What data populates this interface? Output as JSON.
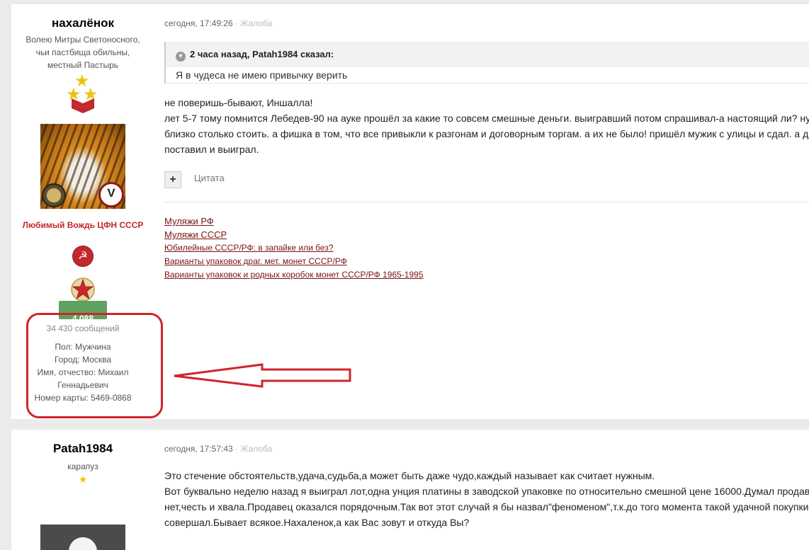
{
  "post1": {
    "author": {
      "name": "нахалёнок",
      "title_lines": [
        "Волею Митры Светоносного,",
        "чьи пастбища обильны,",
        "местный Пастырь"
      ],
      "group": "Любимый Вождь ЦФН СССР",
      "reputation": "4 088",
      "posts_count": "34 430 сообщений",
      "fields": [
        {
          "label": "Пол:",
          "value": "Мужчина"
        },
        {
          "label": "Город:",
          "value": "Москва"
        },
        {
          "label": "Имя, отчество:",
          "value": "Михаил Геннадьевич"
        },
        {
          "label": "Номер карты:",
          "value": "5469-0868"
        }
      ]
    },
    "date": "сегодня, 17:49:26",
    "report": "· Жалоба",
    "quote": {
      "header": "2 часа назад, Patah1984 сказал:",
      "body": "Я в чудеса не имею привычку верить"
    },
    "content": [
      "не поверишь-бывают, Иншалла!",
      "лет 5-7 тому помнится Лебедев-90 на ауке прошёл за какие то совсем смешные деньги. выигравший потом спрашивал-а настоящий ли? ну",
      "близко столько стоить. а фишка в том, что все привыкли к разгонам и договорным торгам. а их не было! пришёл мужик с улицы и сдал. а д",
      "поставил и выиграл."
    ],
    "quote_button": "Цитата",
    "signature_links": [
      {
        "text": "Муляжи РФ",
        "size": "big"
      },
      {
        "text": "Муляжи СССР",
        "size": "big"
      },
      {
        "text": "Юбилейные СССР/РФ: в запайке или без?",
        "size": "small"
      },
      {
        "text": "Варианты упаковок драг. мет. монет СССР/РФ",
        "size": "small"
      },
      {
        "text": "Варианты упаковок и родных коробок монет СССР/РФ 1965-1995",
        "size": "small"
      }
    ]
  },
  "post2": {
    "author": {
      "name": "Patah1984",
      "title": "карапуз"
    },
    "date": "сегодня, 17:57:43",
    "report": "· Жалоба",
    "content": [
      "Это стечение обстоятельств,удача,судьба,а может быть даже чудо,каждый называет как считает нужным.",
      "Вот буквально неделю назад я выиграл лот,одна унция платины в заводской упаковке по относительно смешной цене 16000.Думал продав",
      "нет,честь и хвала.Продавец оказался порядочным.Так вот этот случай я бы назвал\"феноменом\",т.к.до того момента такой удачной покупки",
      "совершал.Бывает всякое.Нахаленок,а как Вас зовут и откуда Вы?"
    ]
  },
  "colors": {
    "highlight": "#d0242b",
    "link": "#7a1212",
    "group": "#c3282d",
    "reputation": "#5fa15f"
  }
}
